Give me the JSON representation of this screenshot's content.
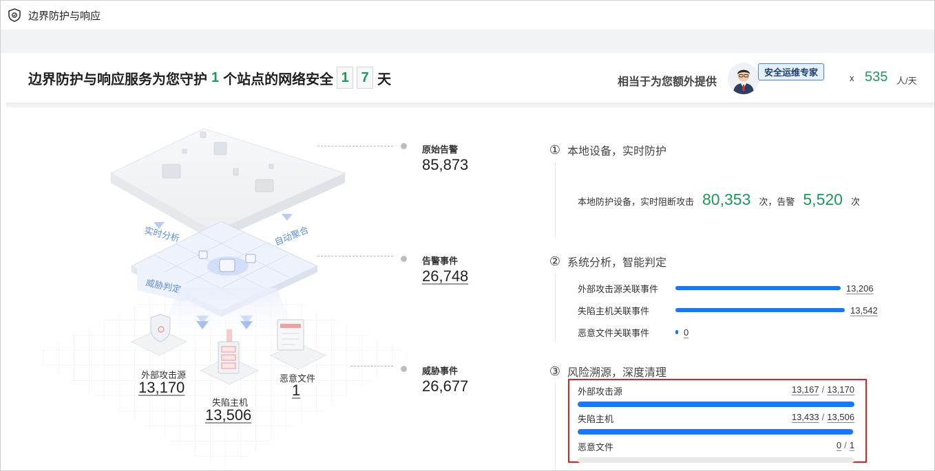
{
  "titlebar": {
    "title": "边界防护与响应",
    "icon": "shield-icon"
  },
  "header": {
    "prefix": "边界防护与响应服务为您守护",
    "sites": "1",
    "middle": "个站点的网络安全",
    "days_digits": [
      "1",
      "7"
    ],
    "days_unit": "天",
    "equiv_label": "相当于为您额外提供",
    "expert_badge": "安全运维专家",
    "times": "x",
    "person_days": "535",
    "person_days_unit": "人/天"
  },
  "illustration": {
    "labels": {
      "realtime": "实时分析",
      "auto": "自动聚合",
      "threat": "威胁判定"
    },
    "sources": [
      {
        "label": "外部攻击源",
        "value": "13,170"
      },
      {
        "label": "失陷主机",
        "value": "13,506"
      },
      {
        "label": "恶意文件",
        "value": "1"
      }
    ]
  },
  "funnel": [
    {
      "label": "原始告警",
      "value": "85,873"
    },
    {
      "label": "告警事件",
      "value": "26,748"
    },
    {
      "label": "威胁事件",
      "value": "26,677"
    }
  ],
  "steps": {
    "step1": {
      "num": "①",
      "title": "本地设备，实时防护",
      "prefix": "本地防护设备，实时阻断攻击",
      "blocked": "80,353",
      "mid": "次，告警",
      "alerts": "5,520",
      "suffix": "次"
    },
    "step2": {
      "num": "②",
      "title": "系统分析，智能判定",
      "rows": [
        {
          "label": "外部攻击源关联事件",
          "value": "13,206",
          "fraction": 0.975
        },
        {
          "label": "失陷主机关联事件",
          "value": "13,542",
          "fraction": 1.0
        },
        {
          "label": "恶意文件关联事件",
          "value": "0",
          "fraction": 0.0
        }
      ]
    },
    "step3": {
      "num": "③",
      "title": "风险溯源，深度清理",
      "rows": [
        {
          "label": "外部攻击源",
          "done": "13,167",
          "sep": "/",
          "total": "13,170",
          "fraction": 0.9998
        },
        {
          "label": "失陷主机",
          "done": "13,433",
          "sep": "/",
          "total": "13,506",
          "fraction": 0.9946
        },
        {
          "label": "恶意文件",
          "done": "0",
          "sep": "/",
          "total": "1",
          "fraction": 0.0
        }
      ]
    }
  },
  "colors": {
    "accent_green": "#1a9a58",
    "bar_blue": "#1677ff",
    "highlight_red": "#e02020"
  }
}
